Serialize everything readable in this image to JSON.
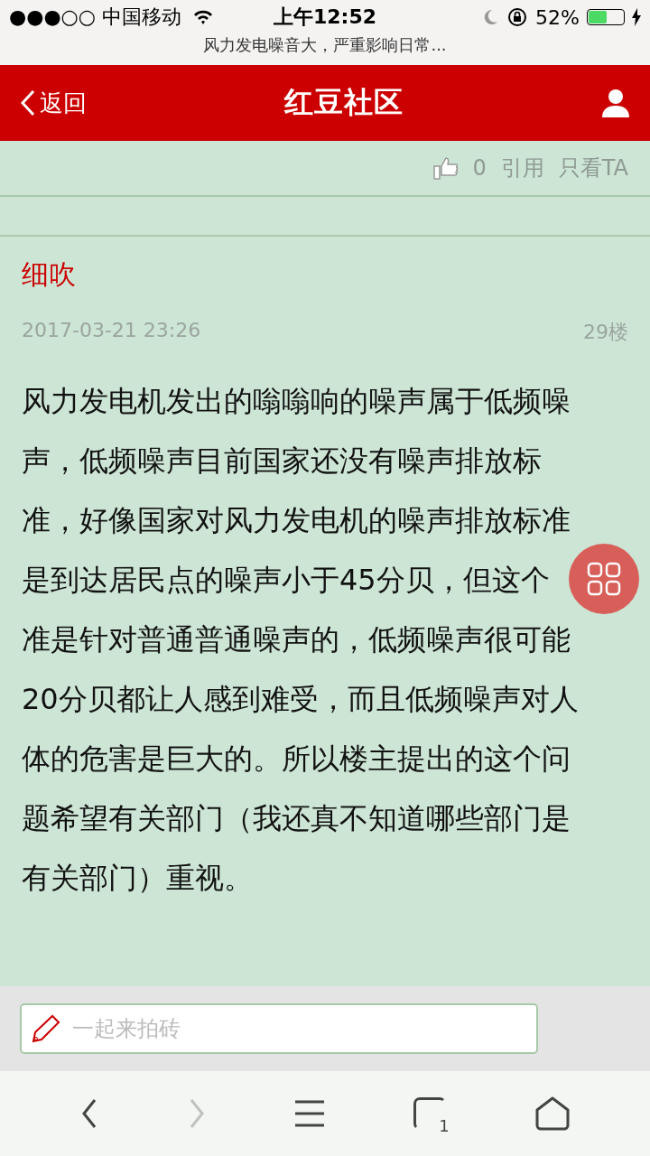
{
  "status_bar": {
    "carrier": "●●●○○ 中国移动",
    "time": "上午12:52",
    "battery": "52%"
  },
  "page_title": "风力发电噪音大，严重影响日常...",
  "header": {
    "back": "返回",
    "title": "红豆社区"
  },
  "post_actions": {
    "likes": "0",
    "quote": "引用",
    "only_author": "只看TA"
  },
  "post": {
    "author": "细吹",
    "date": "2017-03-21 23:26",
    "floor": "29楼",
    "lines": [
      "风力发电机发出的嗡嗡响的噪声属于低频噪",
      "声，低频噪声目前国家还没有噪声排放标",
      "准，好像国家对风力发电机的噪声排放标准",
      "是到达居民点的噪声小于45分贝，但这个",
      "准是针对普通普通噪声的，低频噪声很可能",
      "20分贝都让人感到难受，而且低频噪声对人",
      "体的危害是巨大的。所以楼主提出的这个问",
      "题希望有关部门（我还真不知道哪些部门是",
      "有关部门）重视。"
    ]
  },
  "reply_box": {
    "placeholder": "一起来拍砖"
  },
  "browser_bar": [
    {
      "kind": "back",
      "disabled": false
    },
    {
      "kind": "forward",
      "disabled": true
    },
    {
      "kind": "menu",
      "disabled": false
    },
    {
      "kind": "tabs",
      "disabled": false,
      "count": "1"
    },
    {
      "kind": "home",
      "disabled": false
    }
  ]
}
